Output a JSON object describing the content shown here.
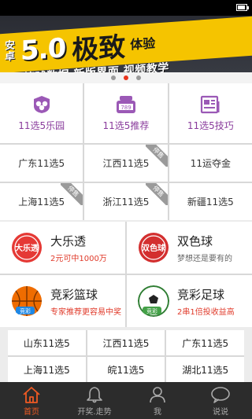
{
  "banner": {
    "brand_line1": "安",
    "brand_line2": "卓",
    "version": "5.0",
    "headline": "极致",
    "headline_suffix": "体验",
    "subline": "篮球数据 新版界面 视频教学",
    "dots": 3,
    "active_dot": 1
  },
  "features": [
    {
      "label": "11选5乐园",
      "icon": "club-badge-icon"
    },
    {
      "label": "11选5推荐",
      "icon": "lottery-machine-icon"
    },
    {
      "label": "11选5技巧",
      "icon": "newspaper-icon"
    }
  ],
  "regions": [
    {
      "label": "广东11选5",
      "tag": ""
    },
    {
      "label": "江西11选5",
      "tag": "停售"
    },
    {
      "label": "11运夺金",
      "tag": ""
    },
    {
      "label": "上海11选5",
      "tag": "停售"
    },
    {
      "label": "浙江11选5",
      "tag": "停售"
    },
    {
      "label": "新疆11选5",
      "tag": ""
    }
  ],
  "lotteries": [
    {
      "title": "大乐透",
      "desc": "2元可中1000万",
      "logo_text": "大乐透",
      "color": "#e53935"
    },
    {
      "title": "双色球",
      "desc": "梦想还是要有的",
      "logo_text": "双色球",
      "color": "#d32f2f"
    },
    {
      "title": "竞彩篮球",
      "desc": "专家推荐更容易中奖",
      "logo_text": "竞彩",
      "color": "#ef6c00"
    },
    {
      "title": "竞彩足球",
      "desc": "2串1倍投收益高",
      "logo_text": "竞彩",
      "color": "#2e7d32"
    }
  ],
  "more_regions": [
    "山东11选5",
    "江西11选5",
    "广东11选5",
    "上海11选5",
    "皖11选5",
    "湖北11选5"
  ],
  "tabs": [
    {
      "label": "首页",
      "icon": "home-icon",
      "active": true
    },
    {
      "label": "开奖.走势",
      "icon": "bell-icon",
      "active": false
    },
    {
      "label": "我",
      "icon": "user-icon",
      "active": false
    },
    {
      "label": "说说",
      "icon": "chat-bubble-icon",
      "active": false
    }
  ]
}
